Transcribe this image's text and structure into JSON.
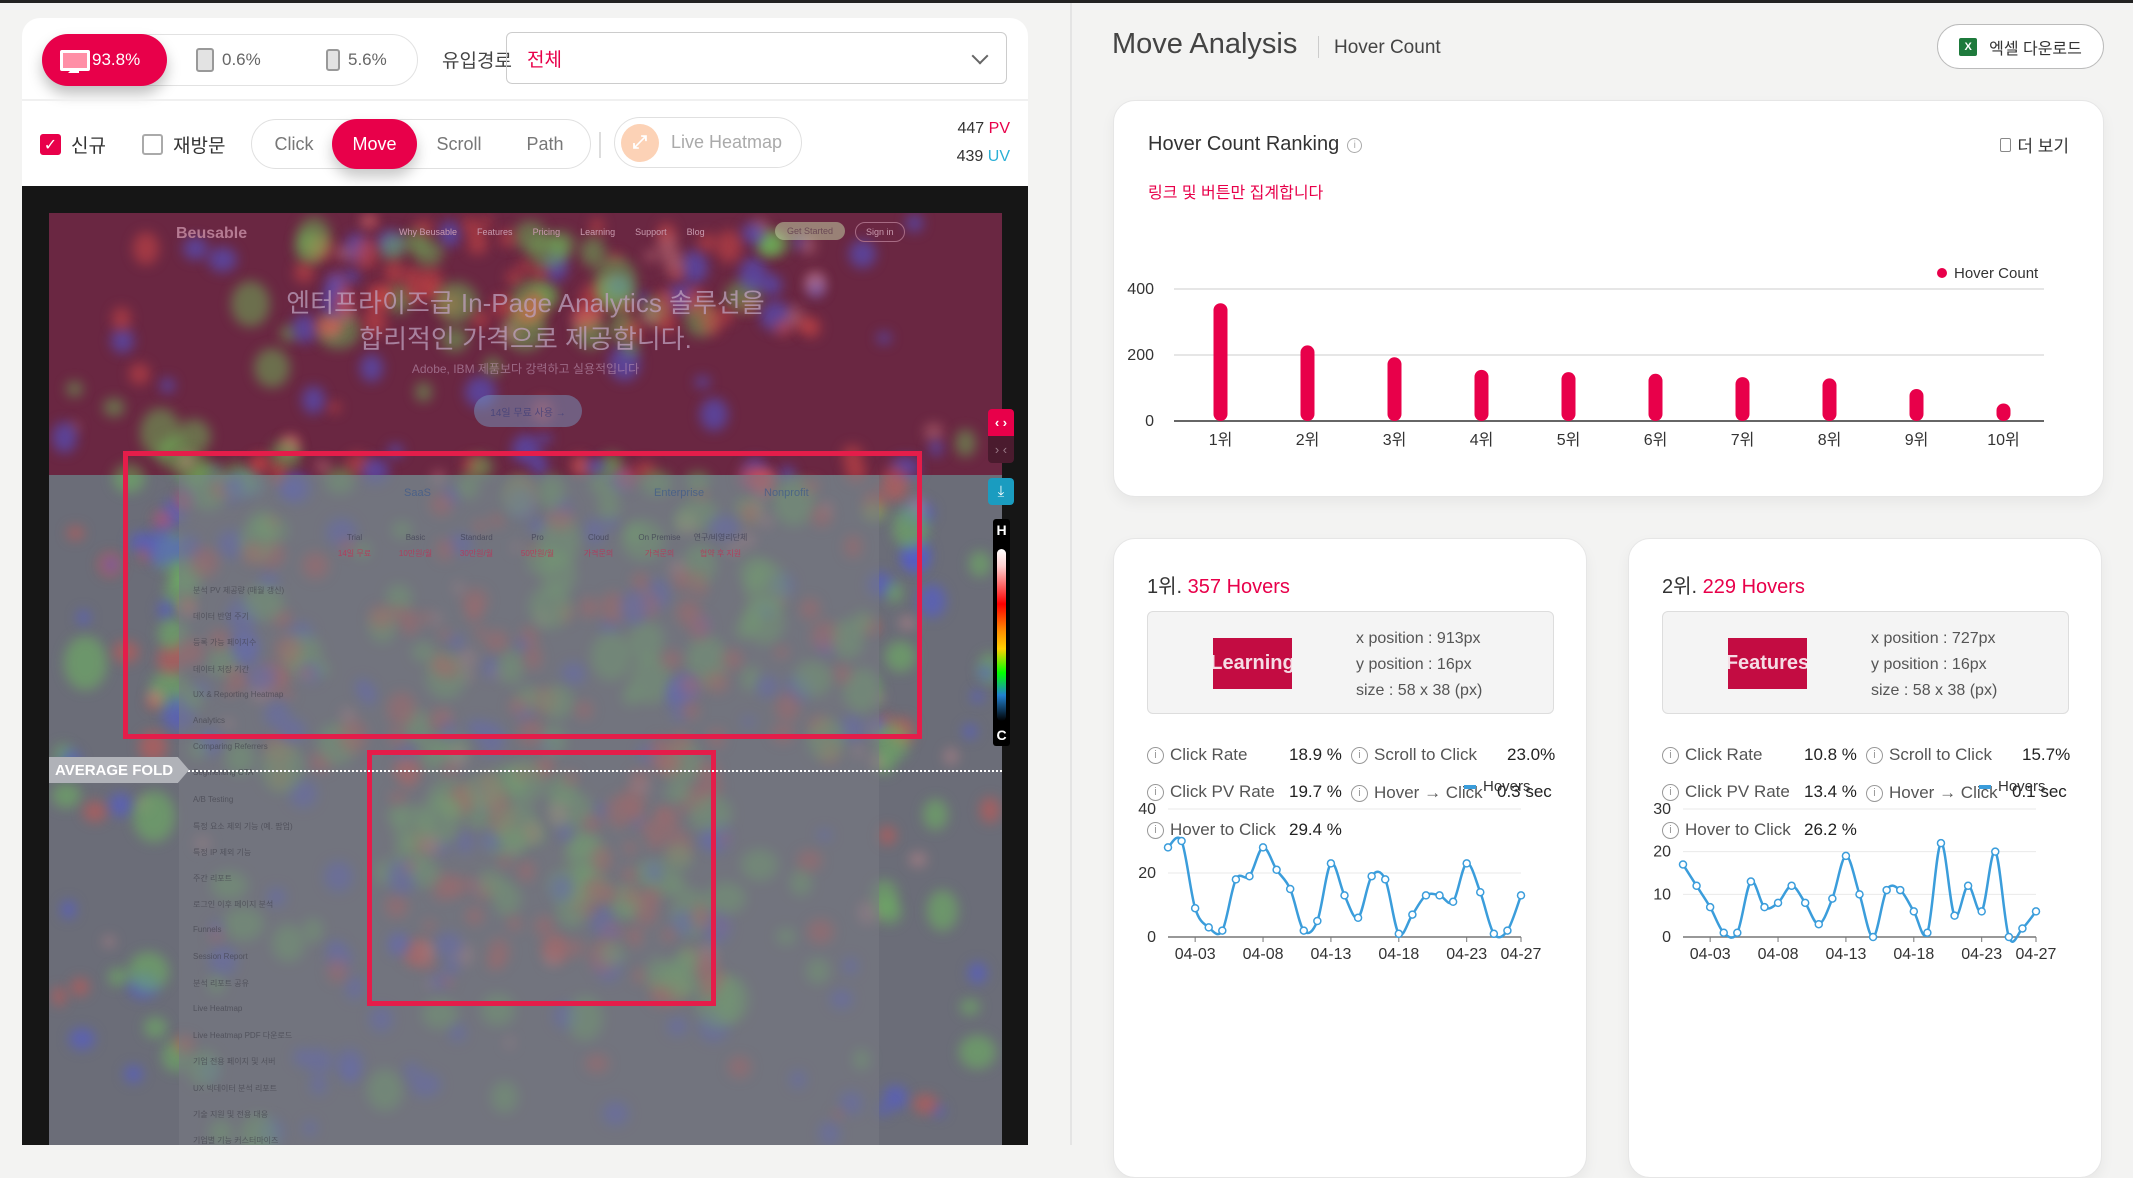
{
  "devices": [
    {
      "name": "desktop",
      "share": "93.8%",
      "active": true
    },
    {
      "name": "tablet",
      "share": "0.6%",
      "active": false
    },
    {
      "name": "mobile",
      "share": "5.6%",
      "active": false
    }
  ],
  "referrer": {
    "label": "유입경로",
    "value": "전체"
  },
  "visitor_filters": [
    {
      "label": "신규",
      "checked": true
    },
    {
      "label": "재방문",
      "checked": false
    }
  ],
  "modes": [
    "Click",
    "Move",
    "Scroll",
    "Path"
  ],
  "active_mode": "Move",
  "live_heatmap_label": "Live Heatmap",
  "stats": {
    "pv_value": "447",
    "pv_unit": "PV",
    "uv_value": "439",
    "uv_unit": "UV"
  },
  "heatmap": {
    "page": {
      "logo": "Beusable",
      "nav": [
        "Why Beusable",
        "Features",
        "Pricing",
        "Learning",
        "Support",
        "Blog"
      ],
      "cta": "Get Started",
      "signin": "Sign in",
      "hero_line1": "엔터프라이즈급 In-Page Analytics 솔루션을",
      "hero_line2": "합리적인 가격으로 제공합니다.",
      "hero_sub": "Adobe, IBM 제품보다 강력하고 실용적입니다",
      "hero_button": "14일 무료 사용 →",
      "table_groups": [
        "SaaS",
        "Enterprise",
        "Nonprofit"
      ],
      "plans": [
        {
          "name": "Trial",
          "price": "14일 무료"
        },
        {
          "name": "Basic",
          "price": "10만원/월"
        },
        {
          "name": "Standard",
          "price": "30만원/월"
        },
        {
          "name": "Pro",
          "price": "50만원/월"
        },
        {
          "name": "Cloud",
          "price": "가격문의"
        },
        {
          "name": "On Premise",
          "price": "가격문의"
        },
        {
          "name": "연구/비영리단체",
          "price": "협약 후 지원"
        }
      ],
      "rows": [
        "분석 PV 제공량 (매월 갱신)",
        "데이터 반영 주기",
        "등록 가능 페이지수",
        "데이터 저장 기간",
        "UX & Reporting Heatmap",
        "Analytics",
        "Comparing Referrers",
        "Segmenting CTA",
        "A/B Testing",
        "특정 요소 제외 기능 (예. 팝업)",
        "특정 IP 제외 기능",
        "주간 리포트",
        "로그인 이후 페이지 분석",
        "Funnels",
        "Session Report",
        "분석 리포트 공유",
        "Live Heatmap",
        "Live Heatmap PDF 다운로드",
        "기업 전용 페이지 및 서버",
        "UX 빅데이터 분석 리포트",
        "기술 지원 및 전용 대응",
        "기업별 기능 커스터마이즈"
      ]
    },
    "fold_label": "AVERAGE FOLD",
    "legend_high": "H",
    "legend_low": "C",
    "colors": {
      "expand": "#e8004a",
      "download": "#1a9cc0",
      "selection": "#e41d4a"
    }
  },
  "right": {
    "title": "Move Analysis",
    "subtitle": "Hover Count",
    "excel_button": "엑셀 다운로드",
    "excel_icon": "X"
  },
  "ranking": {
    "title": "Hover Count Ranking",
    "more": "더 보기",
    "note": "링크 및 버튼만 집계합니다"
  },
  "chart_data": [
    {
      "type": "bar",
      "title": "Hover Count Ranking",
      "categories": [
        "1위",
        "2위",
        "3위",
        "4위",
        "5위",
        "6위",
        "7위",
        "8위",
        "9위",
        "10위"
      ],
      "series": [
        {
          "name": "Hover Count",
          "values": [
            357,
            229,
            193,
            155,
            148,
            143,
            133,
            129,
            97,
            53
          ],
          "color": "#e8004a"
        }
      ],
      "ylim": [
        0,
        400
      ],
      "yticks": [
        0,
        200,
        400
      ],
      "grid": true,
      "legend": "top-right"
    },
    {
      "type": "line",
      "title": "1위 Hovers",
      "x": [
        "04-01",
        "04-02",
        "04-03",
        "04-04",
        "04-05",
        "04-06",
        "04-07",
        "04-08",
        "04-09",
        "04-10",
        "04-11",
        "04-12",
        "04-13",
        "04-14",
        "04-15",
        "04-16",
        "04-17",
        "04-18",
        "04-19",
        "04-20",
        "04-21",
        "04-22",
        "04-23",
        "04-24",
        "04-25",
        "04-26",
        "04-27"
      ],
      "xticks": [
        "04-03",
        "04-08",
        "04-13",
        "04-18",
        "04-23",
        "04-27"
      ],
      "series": [
        {
          "name": "Hovers",
          "values": [
            28,
            30,
            9,
            3,
            2,
            18,
            19,
            28,
            21,
            15,
            2,
            5,
            23,
            13,
            6,
            19,
            18,
            1,
            7,
            13,
            13,
            11,
            23,
            14,
            1,
            2,
            13
          ],
          "color": "#3b9ddb"
        }
      ],
      "ylim": [
        0,
        40
      ],
      "yticks": [
        0,
        20,
        40
      ],
      "grid": true,
      "legend": "top-right"
    },
    {
      "type": "line",
      "title": "2위 Hovers",
      "x": [
        "04-01",
        "04-02",
        "04-03",
        "04-04",
        "04-05",
        "04-06",
        "04-07",
        "04-08",
        "04-09",
        "04-10",
        "04-11",
        "04-12",
        "04-13",
        "04-14",
        "04-15",
        "04-16",
        "04-17",
        "04-18",
        "04-19",
        "04-20",
        "04-21",
        "04-22",
        "04-23",
        "04-24",
        "04-25",
        "04-26",
        "04-27"
      ],
      "xticks": [
        "04-03",
        "04-08",
        "04-13",
        "04-18",
        "04-23",
        "04-27"
      ],
      "series": [
        {
          "name": "Hovers",
          "values": [
            17,
            12,
            7,
            1,
            1,
            13,
            7,
            8,
            12,
            8,
            3,
            9,
            19,
            10,
            0,
            11,
            11,
            6,
            1,
            22,
            5,
            12,
            6,
            20,
            0,
            2,
            6
          ],
          "color": "#3b9ddb"
        }
      ],
      "ylim": [
        0,
        30
      ],
      "yticks": [
        0,
        10,
        20,
        30
      ],
      "grid": true,
      "legend": "top-right"
    }
  ],
  "details": [
    {
      "rank": "1위.",
      "hovers": "357 Hovers",
      "element_label": "Learning",
      "x_position": "x position : 913px",
      "y_position": "y position : 16px",
      "size": "size : 58 x 38 (px)",
      "metrics": {
        "click_rate": {
          "label": "Click Rate",
          "value": "18.9 %"
        },
        "click_pv_rate": {
          "label": "Click PV Rate",
          "value": "19.7 %"
        },
        "hover_to_click": {
          "label": "Hover to Click",
          "value": "29.4 %"
        },
        "scroll_to_click": {
          "label": "Scroll to Click",
          "value": "23.0%"
        },
        "hover_click_time": {
          "label": "Hover → Click",
          "value": "0.3 sec"
        }
      }
    },
    {
      "rank": "2위.",
      "hovers": "229 Hovers",
      "element_label": "Features",
      "x_position": "x position : 727px",
      "y_position": "y position : 16px",
      "size": "size : 58 x 38 (px)",
      "metrics": {
        "click_rate": {
          "label": "Click Rate",
          "value": "10.8 %"
        },
        "click_pv_rate": {
          "label": "Click PV Rate",
          "value": "13.4 %"
        },
        "hover_to_click": {
          "label": "Hover to Click",
          "value": "26.2 %"
        },
        "scroll_to_click": {
          "label": "Scroll to Click",
          "value": "15.7%"
        },
        "hover_click_time": {
          "label": "Hover → Click",
          "value": "0.1 sec"
        }
      }
    }
  ]
}
